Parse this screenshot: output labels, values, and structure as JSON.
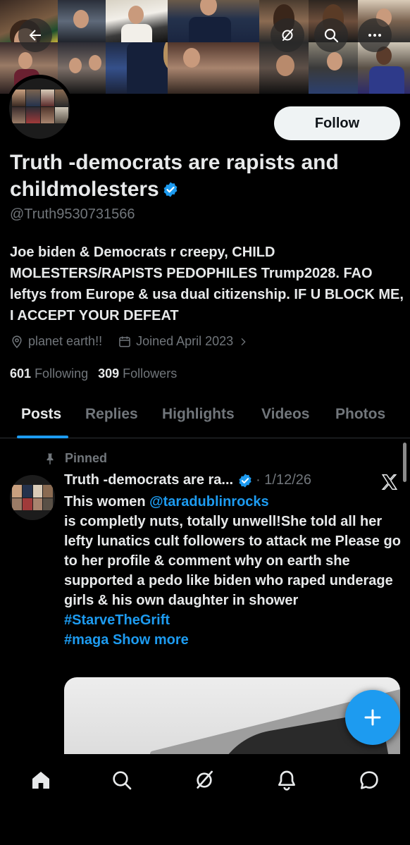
{
  "header": {
    "back_icon": "arrow-left-icon",
    "grok_icon": "grok-icon",
    "search_icon": "search-icon",
    "more_icon": "more-dots-icon"
  },
  "profile": {
    "follow_label": "Follow",
    "name": "Truth -democrats are rapists and childmolesters",
    "verified": true,
    "handle": "@Truth9530731566",
    "bio": "Joe biden & Democrats r creepy, CHILD MOLESTERS/RAPISTS PEDOPHILES Trump2028. FAO leftys from Europe & usa dual citizenship. IF U BLOCK ME, I ACCEPT YOUR DEFEAT",
    "location": "planet earth!!",
    "joined": "Joined April 2023",
    "following_count": "601",
    "following_label": "Following",
    "followers_count": "309",
    "followers_label": "Followers"
  },
  "tabs": [
    {
      "label": "Posts",
      "active": true
    },
    {
      "label": "Replies",
      "active": false
    },
    {
      "label": "Highlights",
      "active": false
    },
    {
      "label": "Videos",
      "active": false
    },
    {
      "label": "Photos",
      "active": false
    }
  ],
  "post": {
    "pinned_label": "Pinned",
    "author": "Truth -democrats are ra...",
    "date": "· 1/12/26",
    "text_intro": "This women ",
    "mention": "@taradublinrocks",
    "text_main": "is completly nuts, totally unwell!She told all her lefty lunatics cult followers to attack me Please go to her profile & comment why on earth she supported a pedo like biden who raped underage girls & his own daughter in shower",
    "hashtag1": "#StarveTheGrift",
    "hashtag2": "#maga",
    "show_more": "Show more"
  },
  "bottom_nav": [
    "home-icon",
    "search-icon",
    "grok-icon",
    "notifications-icon",
    "messages-icon"
  ],
  "colors": {
    "accent": "#1d9bf0",
    "background": "#000000",
    "muted_text": "#71767b",
    "primary_text": "#e7e9ea"
  }
}
